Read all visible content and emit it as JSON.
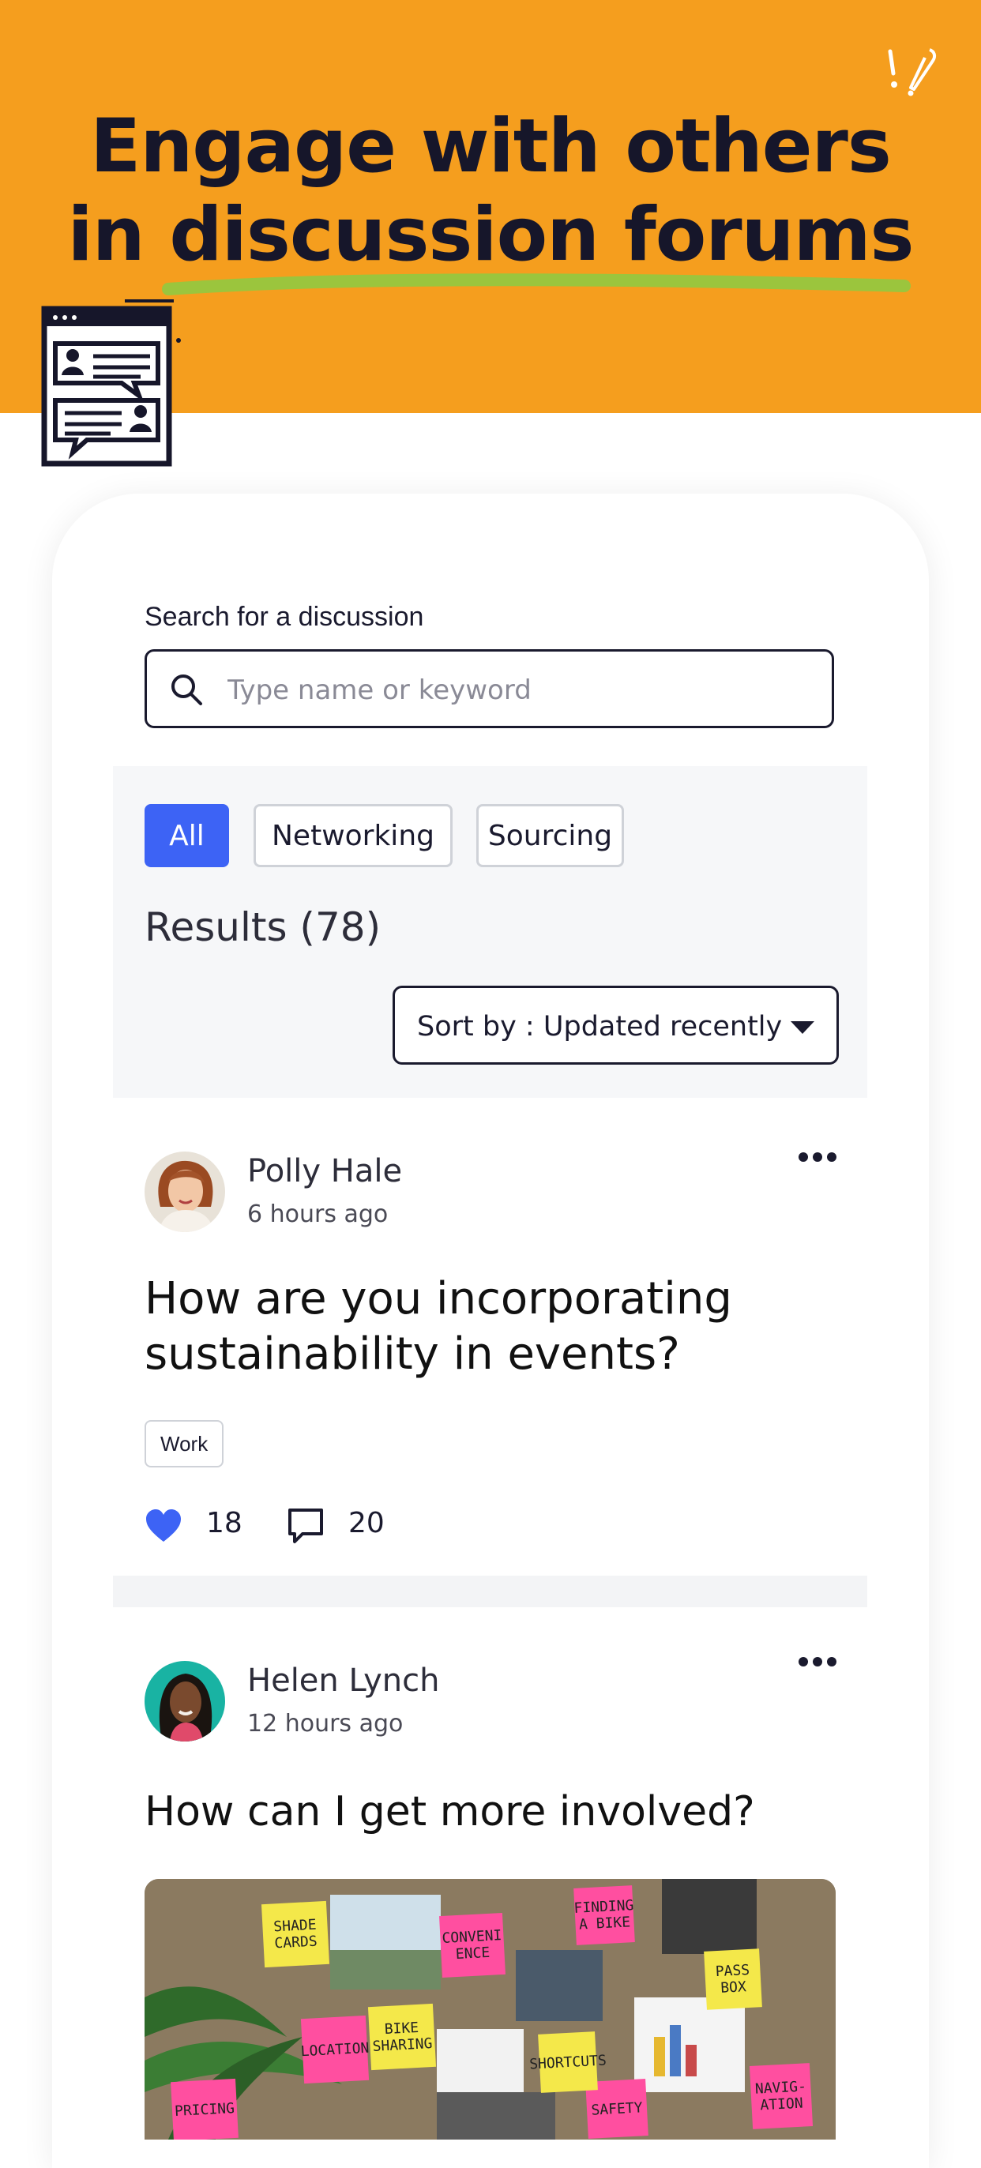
{
  "hero": {
    "headline_line1": "Engage with others",
    "headline_line2": "in discussion forums",
    "background_color": "#F59E1E",
    "underline_color": "#9BC53D"
  },
  "search": {
    "label": "Search for a discussion",
    "placeholder": "Type name or keyword",
    "value": ""
  },
  "filters": {
    "chips": [
      {
        "label": "All",
        "active": true
      },
      {
        "label": "Networking",
        "active": false
      },
      {
        "label": "Sourcing",
        "active": false
      }
    ],
    "results_label": "Results (78)",
    "sort_prefix": "Sort by :",
    "sort_value": "Updated recently",
    "accent_color": "#3D63F5"
  },
  "posts": [
    {
      "author": "Polly Hale",
      "time": "6 hours ago",
      "title": "How are you incorporating sustainability in events?",
      "tag": "Work",
      "likes": "18",
      "comments": "20"
    },
    {
      "author": "Helen Lynch",
      "time": "12 hours ago",
      "title": "How can I get more involved?",
      "photo_notes": [
        "SHADE CARDS",
        "CONVENI ENCE",
        "FINDING A BIKE",
        "LOCATION",
        "SAFETY",
        "PRICING",
        "NAVIG- ATION",
        "PASS BOX",
        "SHORTCUTS",
        "BIKE SHARING"
      ]
    }
  ]
}
